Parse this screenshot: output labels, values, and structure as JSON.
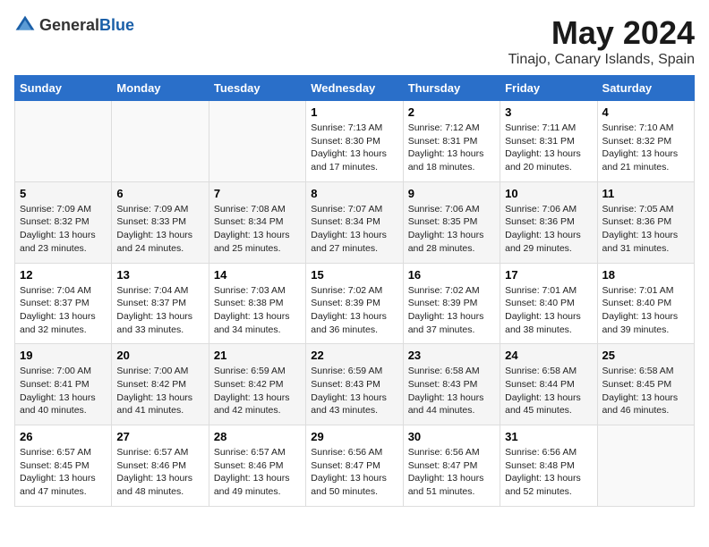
{
  "header": {
    "logo_general": "General",
    "logo_blue": "Blue",
    "title": "May 2024",
    "subtitle": "Tinajo, Canary Islands, Spain"
  },
  "days": [
    "Sunday",
    "Monday",
    "Tuesday",
    "Wednesday",
    "Thursday",
    "Friday",
    "Saturday"
  ],
  "weeks": [
    [
      {
        "date": "",
        "info": ""
      },
      {
        "date": "",
        "info": ""
      },
      {
        "date": "",
        "info": ""
      },
      {
        "date": "1",
        "info": "Sunrise: 7:13 AM\nSunset: 8:30 PM\nDaylight: 13 hours\nand 17 minutes."
      },
      {
        "date": "2",
        "info": "Sunrise: 7:12 AM\nSunset: 8:31 PM\nDaylight: 13 hours\nand 18 minutes."
      },
      {
        "date": "3",
        "info": "Sunrise: 7:11 AM\nSunset: 8:31 PM\nDaylight: 13 hours\nand 20 minutes."
      },
      {
        "date": "4",
        "info": "Sunrise: 7:10 AM\nSunset: 8:32 PM\nDaylight: 13 hours\nand 21 minutes."
      }
    ],
    [
      {
        "date": "5",
        "info": "Sunrise: 7:09 AM\nSunset: 8:32 PM\nDaylight: 13 hours\nand 23 minutes."
      },
      {
        "date": "6",
        "info": "Sunrise: 7:09 AM\nSunset: 8:33 PM\nDaylight: 13 hours\nand 24 minutes."
      },
      {
        "date": "7",
        "info": "Sunrise: 7:08 AM\nSunset: 8:34 PM\nDaylight: 13 hours\nand 25 minutes."
      },
      {
        "date": "8",
        "info": "Sunrise: 7:07 AM\nSunset: 8:34 PM\nDaylight: 13 hours\nand 27 minutes."
      },
      {
        "date": "9",
        "info": "Sunrise: 7:06 AM\nSunset: 8:35 PM\nDaylight: 13 hours\nand 28 minutes."
      },
      {
        "date": "10",
        "info": "Sunrise: 7:06 AM\nSunset: 8:36 PM\nDaylight: 13 hours\nand 29 minutes."
      },
      {
        "date": "11",
        "info": "Sunrise: 7:05 AM\nSunset: 8:36 PM\nDaylight: 13 hours\nand 31 minutes."
      }
    ],
    [
      {
        "date": "12",
        "info": "Sunrise: 7:04 AM\nSunset: 8:37 PM\nDaylight: 13 hours\nand 32 minutes."
      },
      {
        "date": "13",
        "info": "Sunrise: 7:04 AM\nSunset: 8:37 PM\nDaylight: 13 hours\nand 33 minutes."
      },
      {
        "date": "14",
        "info": "Sunrise: 7:03 AM\nSunset: 8:38 PM\nDaylight: 13 hours\nand 34 minutes."
      },
      {
        "date": "15",
        "info": "Sunrise: 7:02 AM\nSunset: 8:39 PM\nDaylight: 13 hours\nand 36 minutes."
      },
      {
        "date": "16",
        "info": "Sunrise: 7:02 AM\nSunset: 8:39 PM\nDaylight: 13 hours\nand 37 minutes."
      },
      {
        "date": "17",
        "info": "Sunrise: 7:01 AM\nSunset: 8:40 PM\nDaylight: 13 hours\nand 38 minutes."
      },
      {
        "date": "18",
        "info": "Sunrise: 7:01 AM\nSunset: 8:40 PM\nDaylight: 13 hours\nand 39 minutes."
      }
    ],
    [
      {
        "date": "19",
        "info": "Sunrise: 7:00 AM\nSunset: 8:41 PM\nDaylight: 13 hours\nand 40 minutes."
      },
      {
        "date": "20",
        "info": "Sunrise: 7:00 AM\nSunset: 8:42 PM\nDaylight: 13 hours\nand 41 minutes."
      },
      {
        "date": "21",
        "info": "Sunrise: 6:59 AM\nSunset: 8:42 PM\nDaylight: 13 hours\nand 42 minutes."
      },
      {
        "date": "22",
        "info": "Sunrise: 6:59 AM\nSunset: 8:43 PM\nDaylight: 13 hours\nand 43 minutes."
      },
      {
        "date": "23",
        "info": "Sunrise: 6:58 AM\nSunset: 8:43 PM\nDaylight: 13 hours\nand 44 minutes."
      },
      {
        "date": "24",
        "info": "Sunrise: 6:58 AM\nSunset: 8:44 PM\nDaylight: 13 hours\nand 45 minutes."
      },
      {
        "date": "25",
        "info": "Sunrise: 6:58 AM\nSunset: 8:45 PM\nDaylight: 13 hours\nand 46 minutes."
      }
    ],
    [
      {
        "date": "26",
        "info": "Sunrise: 6:57 AM\nSunset: 8:45 PM\nDaylight: 13 hours\nand 47 minutes."
      },
      {
        "date": "27",
        "info": "Sunrise: 6:57 AM\nSunset: 8:46 PM\nDaylight: 13 hours\nand 48 minutes."
      },
      {
        "date": "28",
        "info": "Sunrise: 6:57 AM\nSunset: 8:46 PM\nDaylight: 13 hours\nand 49 minutes."
      },
      {
        "date": "29",
        "info": "Sunrise: 6:56 AM\nSunset: 8:47 PM\nDaylight: 13 hours\nand 50 minutes."
      },
      {
        "date": "30",
        "info": "Sunrise: 6:56 AM\nSunset: 8:47 PM\nDaylight: 13 hours\nand 51 minutes."
      },
      {
        "date": "31",
        "info": "Sunrise: 6:56 AM\nSunset: 8:48 PM\nDaylight: 13 hours\nand 52 minutes."
      },
      {
        "date": "",
        "info": ""
      }
    ]
  ]
}
